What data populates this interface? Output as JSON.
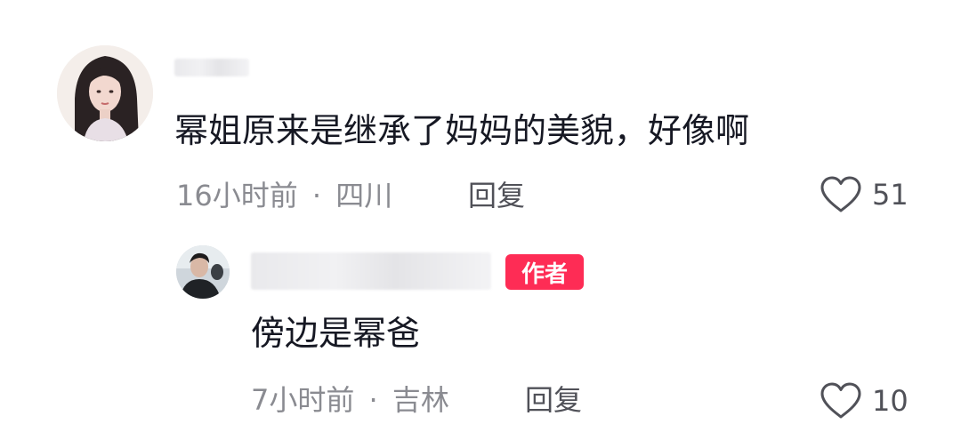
{
  "comments": [
    {
      "avatar_icon": "user-avatar-woman",
      "text": "幂姐原来是继承了妈妈的美貌，好像啊",
      "time": "16小时前",
      "separator": "·",
      "location": "四川",
      "reply_label": "回复",
      "like_icon": "heart-outline-icon",
      "like_count": "51"
    }
  ],
  "replies": [
    {
      "avatar_icon": "user-avatar-man",
      "badge": "作者",
      "text": "傍边是幂爸",
      "time": "7小时前",
      "separator": "·",
      "location": "吉林",
      "reply_label": "回复",
      "like_icon": "heart-outline-icon",
      "like_count": "10"
    }
  ],
  "colors": {
    "badge_bg": "#fe2c55",
    "text": "#161823",
    "meta": "#8a8b91"
  }
}
